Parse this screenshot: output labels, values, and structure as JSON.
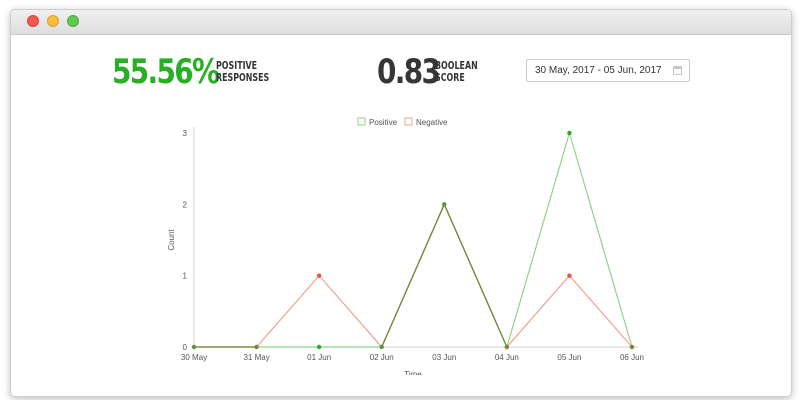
{
  "stats": {
    "positive": {
      "value": "55.56%",
      "label_line1": "POSITIVE",
      "label_line2": "RESPONSES"
    },
    "boolean": {
      "value": "0.83",
      "label_line1": "BOOLEAN",
      "label_line2": "SCORE"
    }
  },
  "date_range": {
    "value": "30 May, 2017 - 05 Jun, 2017",
    "icon": "calendar-icon"
  },
  "colors": {
    "positive": "#28b024",
    "positive_line": "#8fd48a",
    "negative_line": "#f3a08f",
    "negative_point": "#e8553e",
    "overlap": "#6b8a3a"
  },
  "chart_data": {
    "type": "line",
    "categories": [
      "30 May",
      "31 May",
      "01 Jun",
      "02 Jun",
      "03 Jun",
      "04 Jun",
      "05 Jun",
      "06 Jun"
    ],
    "series": [
      {
        "name": "Positive",
        "values": [
          0,
          0,
          0,
          0,
          2,
          0,
          3,
          0
        ]
      },
      {
        "name": "Negative",
        "values": [
          0,
          0,
          1,
          0,
          2,
          0,
          1,
          0
        ]
      }
    ],
    "xlabel": "Time",
    "ylabel": "Count",
    "ylim": [
      0,
      3
    ],
    "yticks": [
      "0",
      "1",
      "2",
      "3"
    ],
    "legend": "top-center",
    "grid": false
  }
}
